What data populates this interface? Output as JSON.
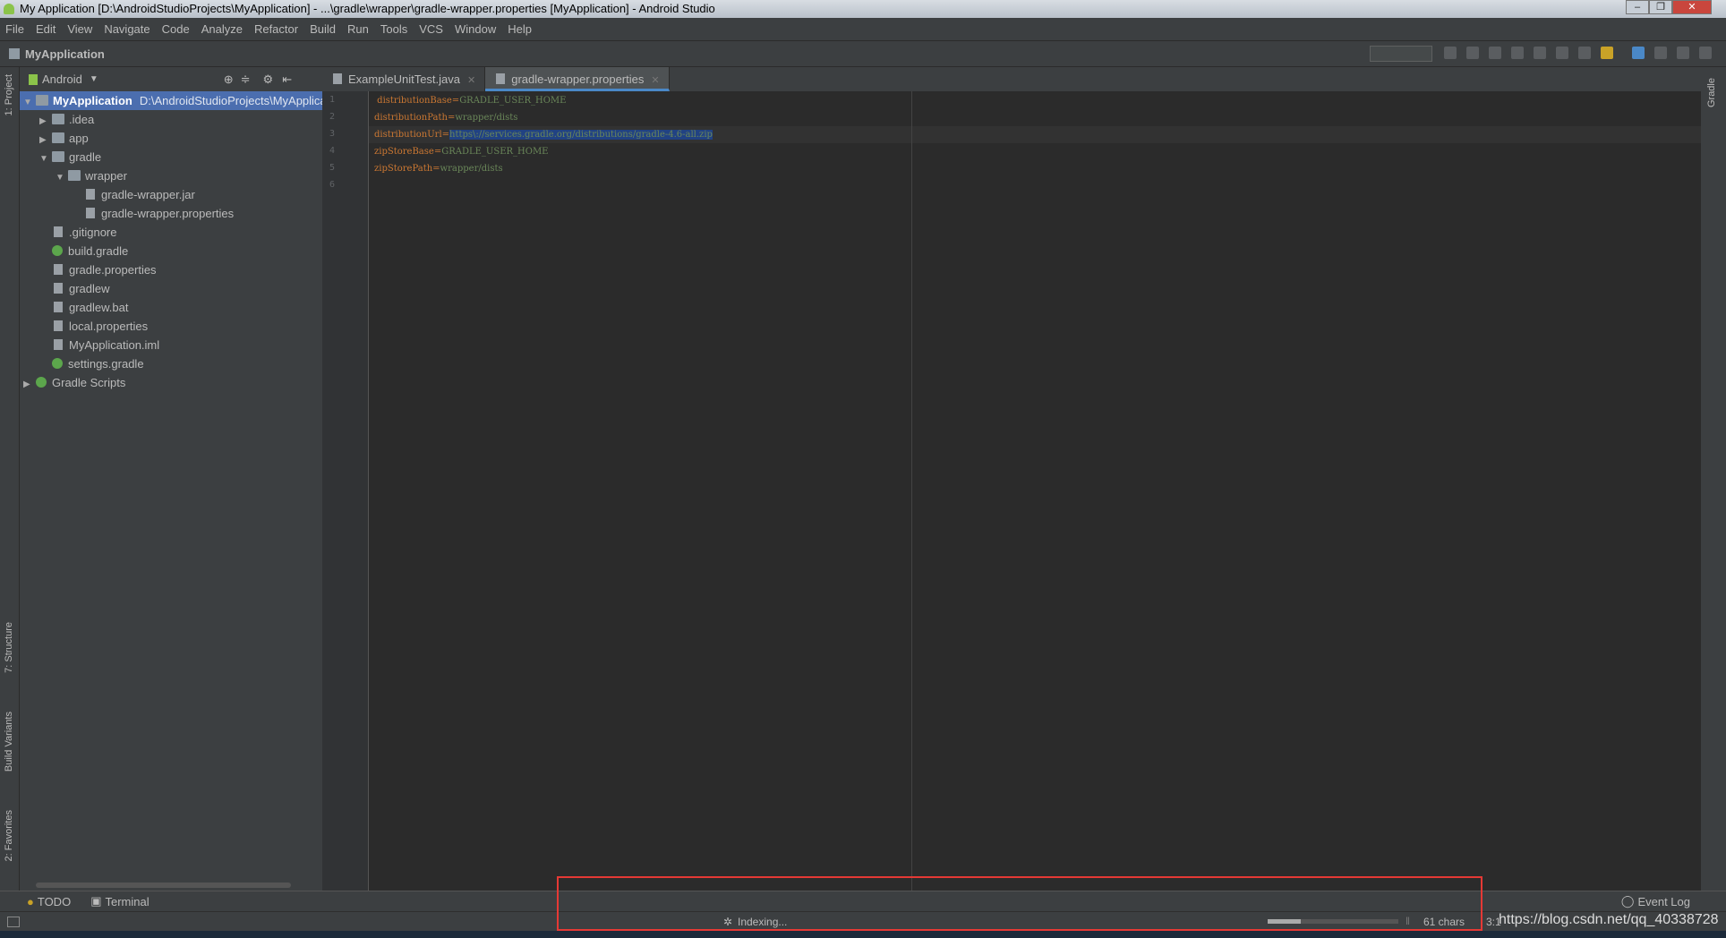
{
  "window": {
    "title": "My Application [D:\\AndroidStudioProjects\\MyApplication] - ...\\gradle\\wrapper\\gradle-wrapper.properties [MyApplication] - Android Studio"
  },
  "menu": [
    "File",
    "Edit",
    "View",
    "Navigate",
    "Code",
    "Analyze",
    "Refactor",
    "Build",
    "Run",
    "Tools",
    "VCS",
    "Window",
    "Help"
  ],
  "breadcrumb": "MyApplication",
  "left_strip": [
    "1: Project",
    "7: Structure",
    "Build Variants",
    "2: Favorites"
  ],
  "right_strip": [
    "Gradle"
  ],
  "project_panel": {
    "view": "Android"
  },
  "tree": [
    {
      "label": "MyApplication",
      "path": "D:\\AndroidStudioProjects\\MyApplication",
      "level": 0,
      "arrow": "▼",
      "icon": "folder"
    },
    {
      "label": ".idea",
      "level": 1,
      "arrow": "▶",
      "icon": "folder"
    },
    {
      "label": "app",
      "level": 1,
      "arrow": "▶",
      "icon": "folder"
    },
    {
      "label": "gradle",
      "level": 1,
      "arrow": "▼",
      "icon": "folder"
    },
    {
      "label": "wrapper",
      "level": 2,
      "arrow": "▼",
      "icon": "folder"
    },
    {
      "label": "gradle-wrapper.jar",
      "level": 3,
      "arrow": "",
      "icon": "file"
    },
    {
      "label": "gradle-wrapper.properties",
      "level": 3,
      "arrow": "",
      "icon": "file"
    },
    {
      "label": ".gitignore",
      "level": 1,
      "arrow": "",
      "icon": "file"
    },
    {
      "label": "build.gradle",
      "level": 1,
      "arrow": "",
      "icon": "gradle"
    },
    {
      "label": "gradle.properties",
      "level": 1,
      "arrow": "",
      "icon": "file"
    },
    {
      "label": "gradlew",
      "level": 1,
      "arrow": "",
      "icon": "file"
    },
    {
      "label": "gradlew.bat",
      "level": 1,
      "arrow": "",
      "icon": "file"
    },
    {
      "label": "local.properties",
      "level": 1,
      "arrow": "",
      "icon": "file"
    },
    {
      "label": "MyApplication.iml",
      "level": 1,
      "arrow": "",
      "icon": "file"
    },
    {
      "label": "settings.gradle",
      "level": 1,
      "arrow": "",
      "icon": "gradle"
    },
    {
      "label": "Gradle Scripts",
      "level": 0,
      "arrow": "▶",
      "icon": "gradle"
    }
  ],
  "tabs": [
    {
      "label": "ExampleUnitTest.java",
      "active": false
    },
    {
      "label": "gradle-wrapper.properties",
      "active": true
    }
  ],
  "code": [
    {
      "n": "1",
      "key": " distributionBase",
      "val": "GRADLE_USER_HOME"
    },
    {
      "n": "2",
      "key": "distributionPath",
      "val": "wrapper/dists"
    },
    {
      "n": "3",
      "key": "distributionUrl",
      "val": "https\\://services.gradle.org/distributions/gradle-4.6-all.zip",
      "selected": true
    },
    {
      "n": "4",
      "key": "zipStoreBase",
      "val": "GRADLE_USER_HOME"
    },
    {
      "n": "5",
      "key": "zipStorePath",
      "val": "wrapper/dists"
    },
    {
      "n": "6",
      "key": "",
      "val": ""
    }
  ],
  "bottom_tools": {
    "todo": "TODO",
    "terminal": "Terminal",
    "event_log": "Event Log"
  },
  "status": {
    "indexing": "Indexing...",
    "progress_percent": 25,
    "chars": "61 chars",
    "position": "3:1",
    "watermark": "https://blog.csdn.net/qq_40338728"
  },
  "colors": {
    "selection": "#4b6eaf",
    "highlight_box": "#e53935",
    "key": "#cc7832",
    "value": "#6a8759"
  }
}
